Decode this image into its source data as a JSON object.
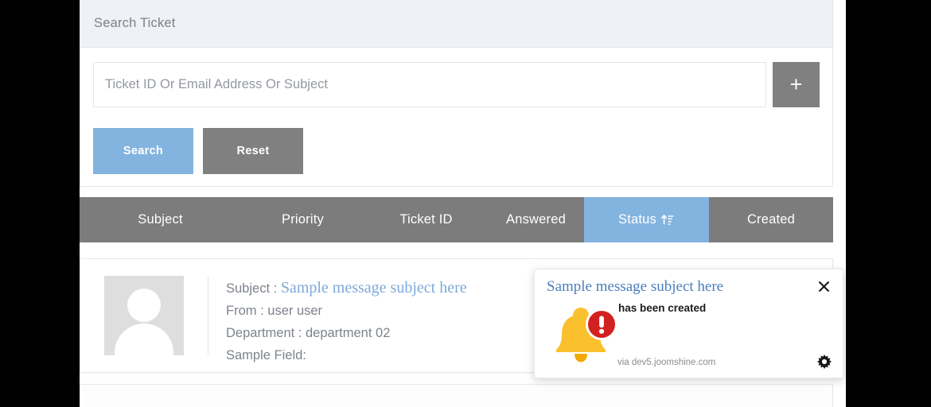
{
  "panel": {
    "title": "Search Ticket",
    "search_placeholder": "Ticket ID Or Email Address Or Subject",
    "search_value": "",
    "add_label": "+",
    "search_button": "Search",
    "reset_button": "Reset"
  },
  "table": {
    "columns": [
      {
        "label": "Subject",
        "sorted": false
      },
      {
        "label": "Priority",
        "sorted": false
      },
      {
        "label": "Ticket ID",
        "sorted": false
      },
      {
        "label": "Answered",
        "sorted": false
      },
      {
        "label": "Status",
        "sorted": true,
        "sort_icon": "sort-ascending-icon"
      },
      {
        "label": "Created",
        "sorted": false
      }
    ],
    "rows": [
      {
        "avatar": "default-user-avatar",
        "subject_label": "Subject :",
        "subject_value": "Sample message subject here",
        "from_label": "From :",
        "from_value": "user user",
        "department_label": "Department :",
        "department_value": "department 02",
        "sample_field_label": "Sample Field:",
        "sample_field_value": ""
      }
    ]
  },
  "toast": {
    "title": "Sample message subject here",
    "body": "has been created",
    "source": "via dev5.joomshine.com",
    "close_icon": "close-icon",
    "gear_icon": "gear-icon",
    "bell_icon": "bell-alert-icon"
  },
  "colors": {
    "accent_blue": "#83b4e0",
    "header_gray": "#7c7c7c",
    "panel_head": "#eef1f6",
    "link_blue": "#7fa9d8",
    "bell_yellow": "#fbc02d",
    "alert_red": "#d32020"
  }
}
